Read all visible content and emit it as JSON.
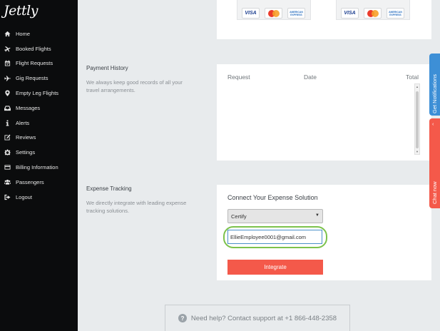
{
  "app": {
    "logo": "Jettly"
  },
  "sidebar": {
    "items": [
      {
        "label": "Home",
        "icon": "home-icon"
      },
      {
        "label": "Booked Flights",
        "icon": "plane-icon"
      },
      {
        "label": "Flight Requests",
        "icon": "calendar-check-icon"
      },
      {
        "label": "Gig Requests",
        "icon": "plane-arrival-icon"
      },
      {
        "label": "Empty Leg Flights",
        "icon": "map-marker-icon"
      },
      {
        "label": "Messages",
        "icon": "inbox-icon"
      },
      {
        "label": "Alerts",
        "icon": "info-icon"
      },
      {
        "label": "Reviews",
        "icon": "edit-icon"
      },
      {
        "label": "Settings",
        "icon": "gear-icon"
      },
      {
        "label": "Billing Information",
        "icon": "credit-card-icon"
      },
      {
        "label": "Passengers",
        "icon": "users-icon"
      },
      {
        "label": "Logout",
        "icon": "sign-out-icon"
      }
    ]
  },
  "cards": {
    "visa": "VISA",
    "amex": "AMERICAN EXPRESS"
  },
  "payment_history": {
    "title": "Payment History",
    "description": "We always keep good records of all your travel arrangements.",
    "columns": [
      "Request",
      "Date",
      "Total"
    ]
  },
  "expense_tracking": {
    "title": "Expense Tracking",
    "description": "We directly integrate with leading expense tracking solutions.",
    "connect_title": "Connect Your Expense Solution",
    "solution_selected": "Certify",
    "email_value": "EllieEmployee0001@gmail.com",
    "integrate_label": "Integrate"
  },
  "support": {
    "text": "Need help? Contact support at +1 866-448-2358"
  },
  "side_tabs": {
    "notifications": "Get Notifications",
    "chat": "Chat now"
  },
  "colors": {
    "sidebar_bg": "#0b0c0d",
    "accent_red": "#f4594a",
    "highlight_green": "#7cc24b",
    "notifications_blue": "#3d8fd6"
  }
}
